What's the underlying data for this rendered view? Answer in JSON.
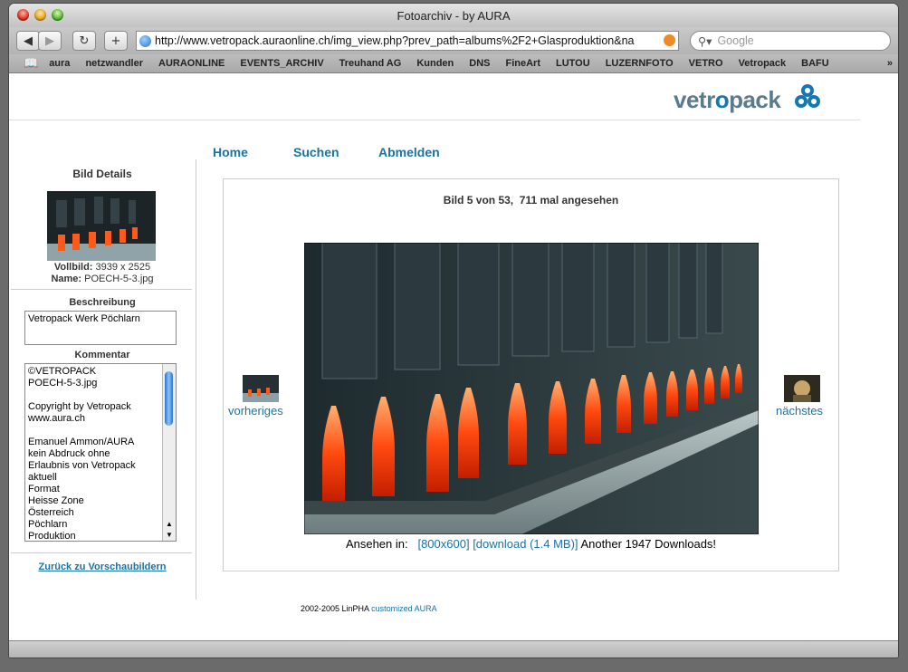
{
  "browser": {
    "window_title": "Fotoarchiv - by AURA",
    "url": "http://www.vetropack.auraonline.ch/img_view.php?prev_path=albums%2F2+Glasproduktion&na",
    "search_placeholder": "Google",
    "bookmarks": [
      "aura",
      "netzwandler",
      "AURAONLINE",
      "EVENTS_ARCHIV",
      "Treuhand AG",
      "Kunden",
      "DNS",
      "FineArt",
      "LUTOU",
      "LUZERNFOTO",
      "VETRO",
      "Vetropack",
      "BAFU"
    ]
  },
  "page": {
    "logo_text_a": "vetr",
    "logo_text_b": "o",
    "logo_text_c": "pack",
    "nav": {
      "home": "Home",
      "search": "Suchen",
      "logout": "Abmelden"
    },
    "left": {
      "title": "Bild Details",
      "full_label": "Vollbild:",
      "full_value": "3939 x 2525",
      "name_label": "Name:",
      "name_value": "POECH-5-3.jpg",
      "desc_title": "Beschreibung",
      "desc_value": "Vetropack Werk Pöchlarn",
      "comment_title": "Kommentar",
      "comment_lines": [
        "©VETROPACK",
        "POECH-5-3.jpg",
        "",
        "Copyright by Vetropack",
        "www.aura.ch",
        "",
        "Emanuel Ammon/AURA",
        "kein Abdruck ohne",
        "Erlaubnis von Vetropack",
        "aktuell",
        "Format",
        "Heisse Zone",
        "Österreich",
        "Pöchlarn",
        "Produktion"
      ],
      "back_link": "Zurück zu Vorschaubildern"
    },
    "main": {
      "counter": "Bild 5 von 53,  711 mal angesehen",
      "prev_label": "vorheriges",
      "next_label": "nächstes",
      "view_label": "Ansehen in:",
      "size_link": "[800x600]",
      "download_link": "[download (1.4 MB)]",
      "downloads_text": "Another 1947 Downloads!"
    },
    "footer": {
      "text": "2002-2005 LinPHA ",
      "link": "customized AURA"
    }
  },
  "colors": {
    "accent": "#1a73a0",
    "logo_gray": "#5a7b8c",
    "logo_blue": "#1577b3"
  }
}
